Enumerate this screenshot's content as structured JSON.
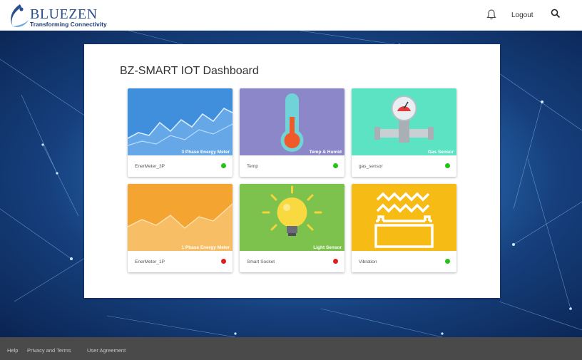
{
  "header": {
    "logo_name": "BLUEZEN",
    "logo_tagline": "Transforming Connectivity",
    "logout_label": "Logout"
  },
  "dashboard": {
    "title": "BZ-SMART IOT Dashboard",
    "cards": [
      {
        "image_label": "3 Phase Energy Meter",
        "name": "EnerMeter_3P",
        "status": "online",
        "status_color": "#22c31b",
        "image": "line-chart"
      },
      {
        "image_label": "Temp & Humid",
        "name": "Temp",
        "status": "online",
        "status_color": "#22c31b",
        "image": "thermometer"
      },
      {
        "image_label": "Gas Sensor",
        "name": "gas_sensor",
        "status": "online",
        "status_color": "#22c31b",
        "image": "gauge-pipe"
      },
      {
        "image_label": "1 Phase Energy Meter",
        "name": "EnerMeter_1P",
        "status": "offline",
        "status_color": "#e21b1b",
        "image": "area-chart"
      },
      {
        "image_label": "Light Sensor",
        "name": "Smart Socket",
        "status": "offline",
        "status_color": "#e21b1b",
        "image": "light-bulb"
      },
      {
        "image_label": "",
        "name": "Vibration",
        "status": "online",
        "status_color": "#22c31b",
        "image": "vibration-waves"
      }
    ]
  },
  "footer": {
    "links": [
      "Help",
      "Privacy and Terms",
      "User Agreement"
    ]
  },
  "colors": {
    "card_blue": "#3f8fdc",
    "card_purple": "#8b87c9",
    "card_teal": "#5ce3c4",
    "card_orange": "#f3a431",
    "card_green": "#7cc24d",
    "card_yellow": "#f7bb15"
  }
}
